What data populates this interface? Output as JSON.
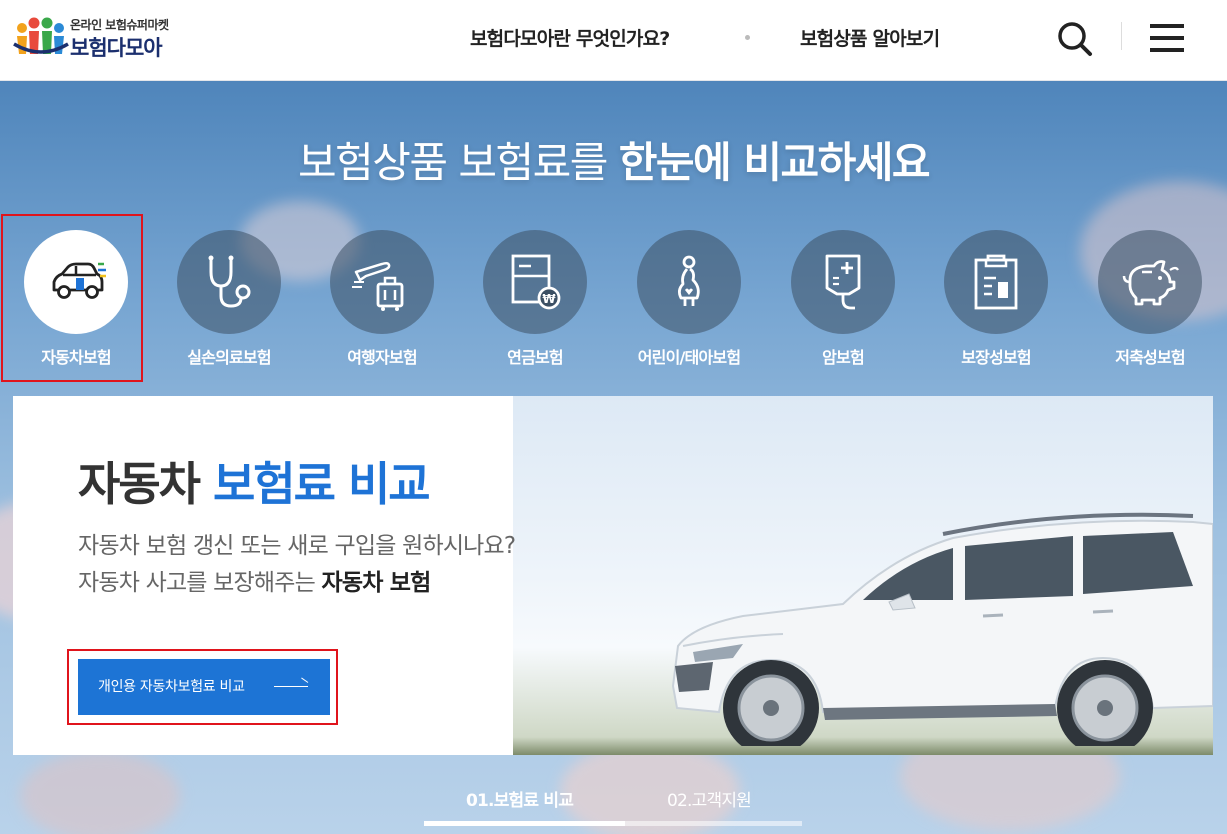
{
  "header": {
    "logo_sub": "온라인 보험슈퍼마켓",
    "logo_main": "보험다모아",
    "nav": [
      "보험다모아란 무엇인가요?",
      "보험상품 알아보기"
    ]
  },
  "hero": {
    "title_light": "보험상품 보험료를 ",
    "title_bold": "한눈에 비교하세요"
  },
  "categories": [
    {
      "label": "자동차보험",
      "icon": "car-icon",
      "active": true
    },
    {
      "label": "실손의료보험",
      "icon": "stethoscope-icon",
      "active": false
    },
    {
      "label": "여행자보험",
      "icon": "airplane-luggage-icon",
      "active": false
    },
    {
      "label": "연금보험",
      "icon": "pension-document-icon",
      "active": false
    },
    {
      "label": "어린이/태아보험",
      "icon": "pregnant-woman-icon",
      "active": false
    },
    {
      "label": "암보험",
      "icon": "iv-drip-icon",
      "active": false
    },
    {
      "label": "보장성보험",
      "icon": "clipboard-icon",
      "active": false
    },
    {
      "label": "저축성보험",
      "icon": "piggy-bank-icon",
      "active": false
    }
  ],
  "panel": {
    "title_dark": "자동차 ",
    "title_blue": "보험료 비교",
    "desc_line1": "자동차 보험 갱신 또는 새로 구입을 원하시나요?",
    "desc_line2_prefix": "자동차 사고를 보장해주는 ",
    "desc_line2_bold": "자동차 보험",
    "cta_label": "개인용 자동차보험료 비교"
  },
  "tabs": [
    {
      "label": "01.보험료 비교",
      "active": true
    },
    {
      "label": "02.고객지원",
      "active": false
    }
  ],
  "colors": {
    "accent_blue": "#1e73d6",
    "highlight_red": "#e0141c"
  }
}
